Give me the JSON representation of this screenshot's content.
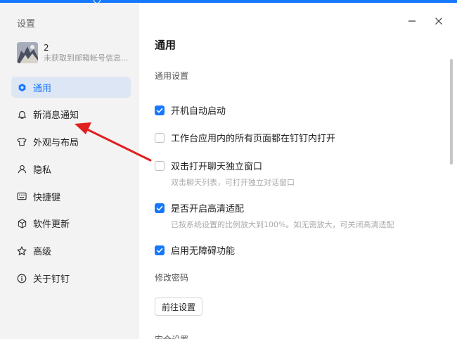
{
  "window": {
    "title": "设置"
  },
  "user": {
    "name": "2",
    "subtitle": "未获取到邮箱帐号信息..."
  },
  "sidebar": {
    "items": [
      {
        "label": "通用",
        "icon": "settings-icon",
        "active": true
      },
      {
        "label": "新消息通知",
        "icon": "bell-icon",
        "active": false
      },
      {
        "label": "外观与布局",
        "icon": "shirt-icon",
        "active": false
      },
      {
        "label": "隐私",
        "icon": "person-icon",
        "active": false
      },
      {
        "label": "快捷键",
        "icon": "keyboard-icon",
        "active": false
      },
      {
        "label": "软件更新",
        "icon": "cube-icon",
        "active": false
      },
      {
        "label": "高级",
        "icon": "star-icon",
        "active": false
      },
      {
        "label": "关于钉钉",
        "icon": "info-icon",
        "active": false
      }
    ]
  },
  "main": {
    "title": "通用",
    "section_general": "通用设置",
    "options": [
      {
        "label": "开机自动启动",
        "checked": true,
        "desc": ""
      },
      {
        "label": "工作台应用内的所有页面都在钉钉内打开",
        "checked": false,
        "desc": ""
      },
      {
        "label": "双击打开聊天独立窗口",
        "checked": false,
        "desc": "双击聊天列表，可打开独立对话窗口"
      },
      {
        "label": "是否开启高清适配",
        "checked": true,
        "desc": "已按系统设置的比例放大到100%。如无需放大，可关闭高清适配"
      },
      {
        "label": "启用无障碍功能",
        "checked": true,
        "desc": ""
      }
    ],
    "section_password": "修改密码",
    "goto_button": "前往设置",
    "section_cut": "安全设置"
  },
  "colors": {
    "accent": "#1677ff",
    "sidebar_bg": "#f3f3f3",
    "active_bg": "#dde6f4",
    "annotation_arrow": "#e02020"
  }
}
